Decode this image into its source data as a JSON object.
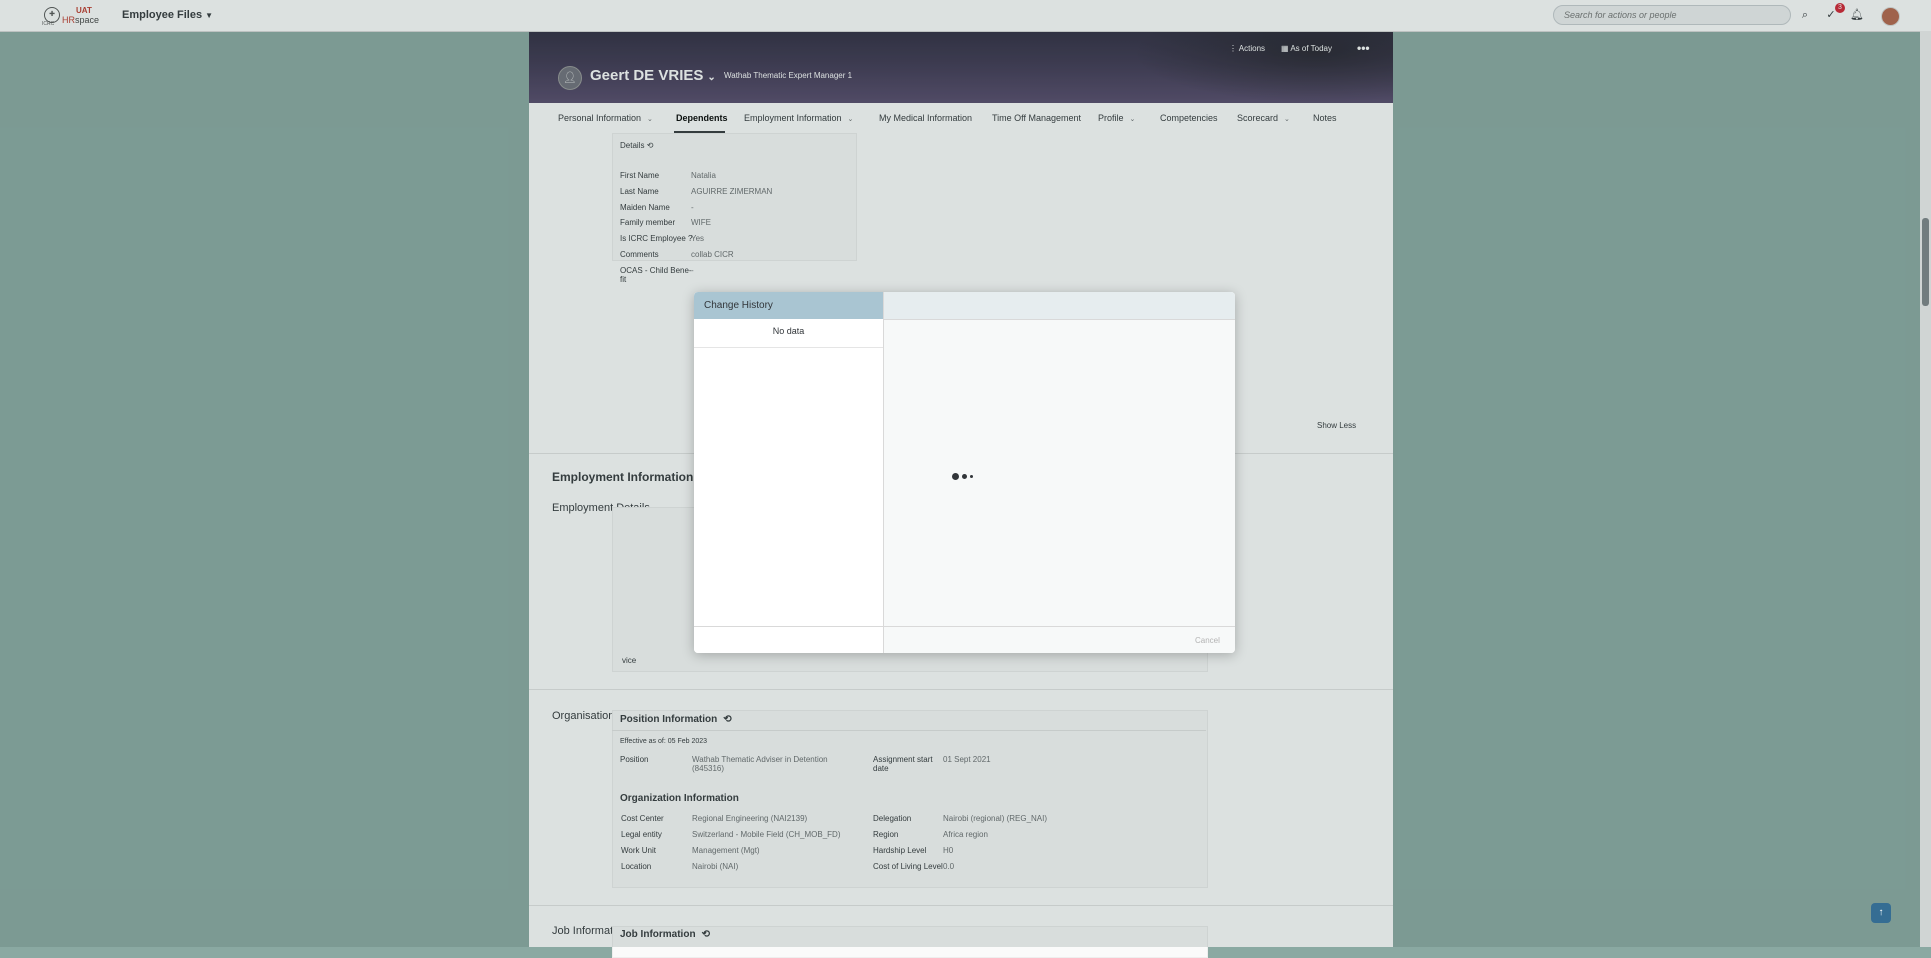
{
  "shell": {
    "logo_uat": "UAT",
    "logo_icrc": "ICRC",
    "logo_hr": "HR",
    "logo_space": "space",
    "app_name": "Employee Files",
    "search_placeholder": "Search for actions or people",
    "notification_count": "3"
  },
  "header": {
    "name": "Geert DE VRIES",
    "job_title": "Wathab Thematic Expert Manager 1",
    "actions_label": "Actions",
    "as_of_label": "As of Today"
  },
  "tabs": [
    {
      "label": "Personal Information"
    },
    {
      "label": "Dependents"
    },
    {
      "label": "Employment Information"
    },
    {
      "label": "My Medical Information"
    },
    {
      "label": "Time Off Management"
    },
    {
      "label": "Profile"
    },
    {
      "label": "Competencies"
    },
    {
      "label": "Scorecard"
    },
    {
      "label": "Notes"
    }
  ],
  "dependents": {
    "details_label": "Details",
    "fields": [
      {
        "label": "First Name",
        "value": "Natalia"
      },
      {
        "label": "Last Name",
        "value": "AGUIRRE ZIMERMAN"
      },
      {
        "label": "Maiden Name",
        "value": "-"
      },
      {
        "label": "Family member",
        "value": "WIFE"
      },
      {
        "label": "Is ICRC Employee ?",
        "value": "Yes"
      },
      {
        "label": "Comments",
        "value": "collab CICR"
      },
      {
        "label": "OCAS - Child Bene-",
        "label2": "fit",
        "value": "-"
      }
    ],
    "show_less": "Show Less"
  },
  "employment": {
    "section_title": "Employment Information",
    "details_label": "Employment Details",
    "partial_text": "vice"
  },
  "organisational": {
    "section_label": "Organisational Information",
    "position_heading": "Position Information",
    "effective": "Effective as of: 05 Feb 2023",
    "position_label": "Position",
    "position_value": "Wathab Thematic Adviser in Detention",
    "position_value2": "(845316)",
    "assignment_label": "Assignment start",
    "assignment_label2": "date",
    "assignment_value": "01 Sept 2021",
    "org_heading": "Organization Information",
    "left_fields": [
      {
        "label": "Cost Center",
        "value": "Regional Engineering (NAI2139)"
      },
      {
        "label": "Legal entity",
        "value": "Switzerland - Mobile Field (CH_MOB_FD)"
      },
      {
        "label": "Work Unit",
        "value": "Management (Mgt)"
      },
      {
        "label": "Location",
        "value": "Nairobi (NAI)"
      }
    ],
    "right_fields": [
      {
        "label": "Delegation",
        "value": "Nairobi (regional) (REG_NAI)"
      },
      {
        "label": "Region",
        "value": "Africa region"
      },
      {
        "label": "Hardship Level",
        "value": "H0"
      },
      {
        "label": "Cost of Living Level",
        "value": "0.0"
      }
    ]
  },
  "job": {
    "section_label": "Job Information",
    "heading": "Job Information"
  },
  "dialog": {
    "title": "Change History",
    "no_data": "No data",
    "cancel": "Cancel"
  }
}
